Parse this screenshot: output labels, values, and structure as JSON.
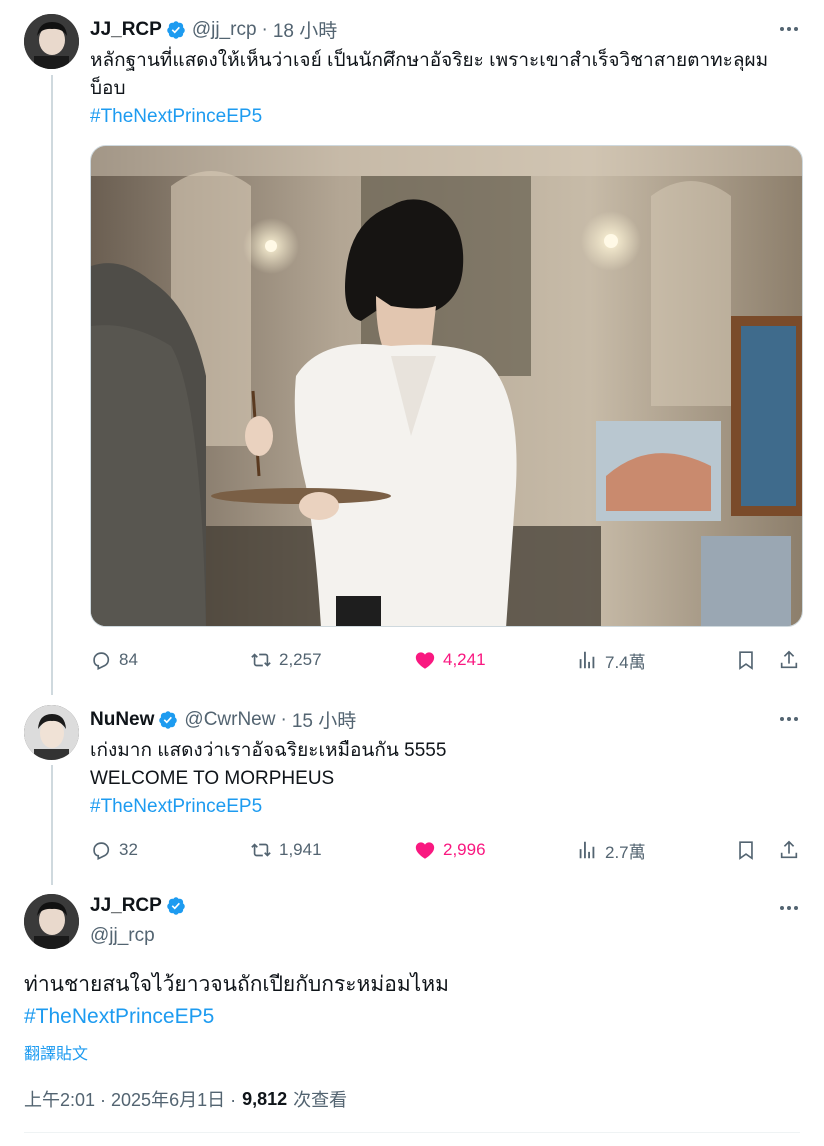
{
  "tweets": [
    {
      "name": "JJ_RCP",
      "handle": "@jj_rcp",
      "sep": "·",
      "time": "18 小時",
      "text_lines": [
        "หลักฐานที่แสดงให้เห็นว่าเจย์ เป็นนักศึกษาอัจริยะ  เพราะเขาสำเร็จวิชาสายตาทะลุผม",
        "บ็อบ"
      ],
      "hashtag": "#TheNextPrinceEP5",
      "media_icon": "painting-photo",
      "actions": {
        "replies": "84",
        "retweets": "2,257",
        "likes": "4,241",
        "views": "7.4萬"
      }
    },
    {
      "name": "NuNew",
      "handle": "@CwrNew",
      "sep": "·",
      "time": "15 小時",
      "text_lines": [
        "เก่งมาก แสดงว่าเราอัจฉริยะเหมือนกัน 5555",
        "WELCOME TO MORPHEUS"
      ],
      "hashtag": "#TheNextPrinceEP5",
      "actions": {
        "replies": "32",
        "retweets": "1,941",
        "likes": "2,996",
        "views": "2.7萬"
      }
    }
  ],
  "main_tweet": {
    "name": "JJ_RCP",
    "handle": "@jj_rcp",
    "text": "ท่านชายสนใจไว้ยาวจนถักเปียกับกระหม่อมไหม",
    "hashtag": "#TheNextPrinceEP5",
    "translate": "翻譯貼文",
    "time": "上午2:01 · 2025年6月1日 ·",
    "views_count": "9,812",
    "views_label": "次查看"
  },
  "colors": {
    "accent": "#1d9bf0",
    "like": "#f91880",
    "muted": "#536471",
    "text": "#0f1419"
  }
}
